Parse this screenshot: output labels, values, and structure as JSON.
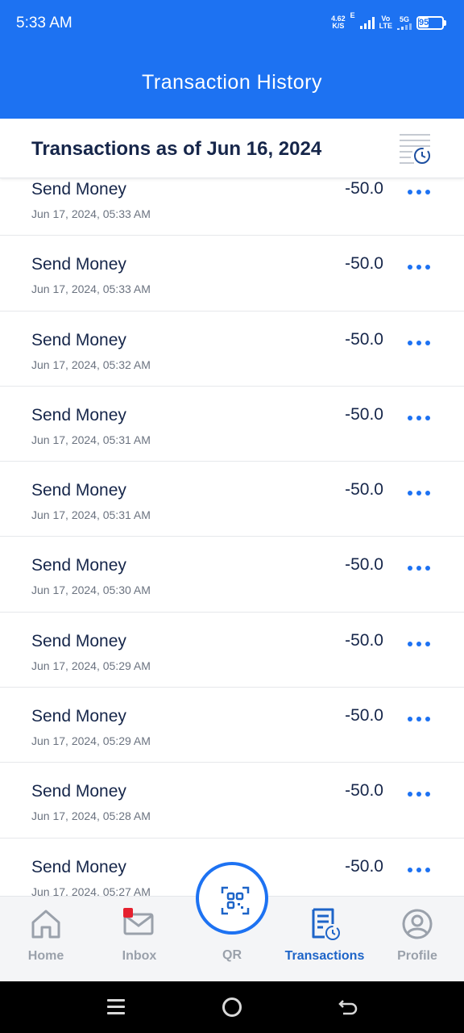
{
  "status_bar": {
    "time": "5:33 AM",
    "net_speed": "4.62",
    "net_unit": "K/S",
    "net_type_1": "E",
    "volte_top": "Vo",
    "volte_bottom": "LTE",
    "net_type_2": "5G",
    "battery": "95"
  },
  "header": {
    "title": "Transaction History"
  },
  "subheader": {
    "title": "Transactions as of Jun 16, 2024",
    "filter_icon": "history-filter-icon"
  },
  "transactions": [
    {
      "name": "Send Money",
      "date": "Jun 17, 2024, 05:33 AM",
      "amount": "-50.0"
    },
    {
      "name": "Send Money",
      "date": "Jun 17, 2024, 05:33 AM",
      "amount": "-50.0"
    },
    {
      "name": "Send Money",
      "date": "Jun 17, 2024, 05:32 AM",
      "amount": "-50.0"
    },
    {
      "name": "Send Money",
      "date": "Jun 17, 2024, 05:31 AM",
      "amount": "-50.0"
    },
    {
      "name": "Send Money",
      "date": "Jun 17, 2024, 05:31 AM",
      "amount": "-50.0"
    },
    {
      "name": "Send Money",
      "date": "Jun 17, 2024, 05:30 AM",
      "amount": "-50.0"
    },
    {
      "name": "Send Money",
      "date": "Jun 17, 2024, 05:29 AM",
      "amount": "-50.0"
    },
    {
      "name": "Send Money",
      "date": "Jun 17, 2024, 05:29 AM",
      "amount": "-50.0"
    },
    {
      "name": "Send Money",
      "date": "Jun 17, 2024, 05:28 AM",
      "amount": "-50.0"
    },
    {
      "name": "Send Money",
      "date": "Jun 17, 2024, 05:27 AM",
      "amount": "-50.0"
    }
  ],
  "bottom_nav": {
    "home": "Home",
    "inbox": "Inbox",
    "qr": "QR",
    "transactions": "Transactions",
    "profile": "Profile",
    "active": "transactions"
  },
  "colors": {
    "brand": "#1d72f2",
    "active_tab": "#1d64c8",
    "text": "#16264a",
    "badge": "#e5202e"
  }
}
